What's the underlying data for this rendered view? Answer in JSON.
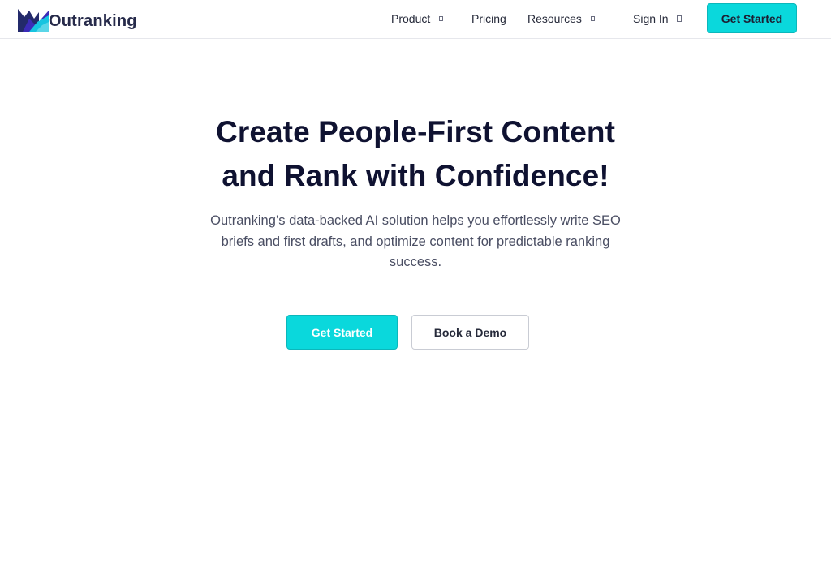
{
  "header": {
    "logo_text": "Outranking",
    "nav": [
      {
        "label": "Product",
        "has_dropdown": true
      },
      {
        "label": "Pricing",
        "has_dropdown": false
      },
      {
        "label": "Resources",
        "has_dropdown": true
      }
    ],
    "sign_in_label": "Sign In",
    "get_started_label": "Get Started"
  },
  "hero": {
    "title_line1": "Create People-First Content",
    "title_line2": "and Rank with Confidence!",
    "subtitle_line1": "Outranking’s data-backed AI solution helps you effortlessly write SEO",
    "subtitle_line2": "briefs and first drafts, and optimize content for predictable ranking",
    "subtitle_line3": "success.",
    "primary_cta": "Get Started",
    "secondary_cta": "Book a Demo"
  },
  "colors": {
    "accent": "#0ad8dc",
    "heading": "#0f1231",
    "body_text": "#4a4e63",
    "logo_purple": "#3b2bb8",
    "logo_teal": "#16c4e0"
  },
  "icons": {
    "logo": "outranking-logo-icon",
    "dropdown": "dropdown-indicator-icon",
    "sign_in": "sign-in-indicator-icon"
  }
}
